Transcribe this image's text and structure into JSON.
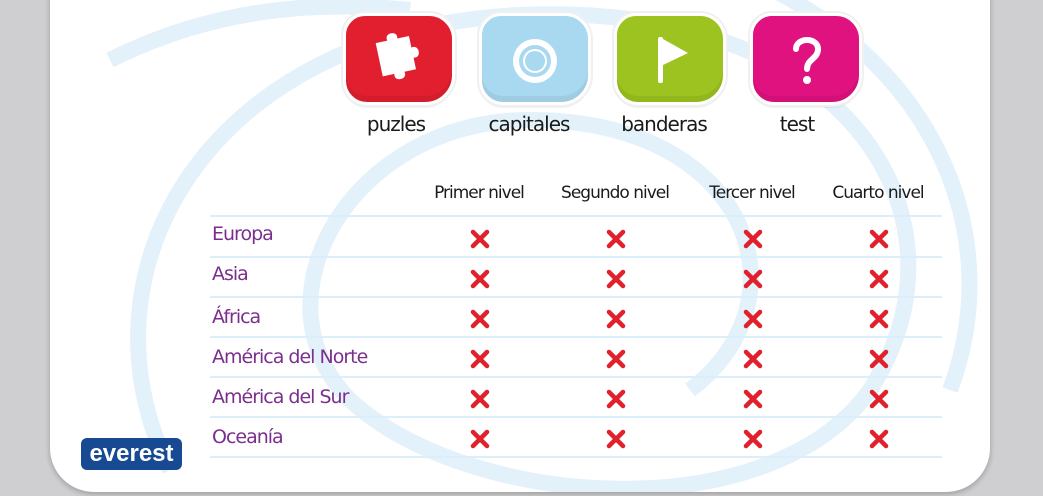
{
  "modes": [
    {
      "label": "puzles",
      "icon": "puzzle-piece-icon",
      "color": "#e21f2f"
    },
    {
      "label": "capitales",
      "icon": "target-ring-icon",
      "color": "#a9d9f0"
    },
    {
      "label": "banderas",
      "icon": "flag-icon",
      "color": "#9cc31f"
    },
    {
      "label": "test",
      "icon": "question-mark-icon",
      "color": "#e0127f"
    }
  ],
  "levels": [
    "Primer nivel",
    "Segundo nivel",
    "Tercer nivel",
    "Cuarto nivel"
  ],
  "regions": [
    "Europa",
    "Asia",
    "África",
    "América del Norte",
    "América del Sur",
    "Oceanía"
  ],
  "mark_color": "#e0202a",
  "region_color": "#7a2e8e",
  "brand": {
    "logo_text": "everest",
    "color": "#174a92"
  }
}
